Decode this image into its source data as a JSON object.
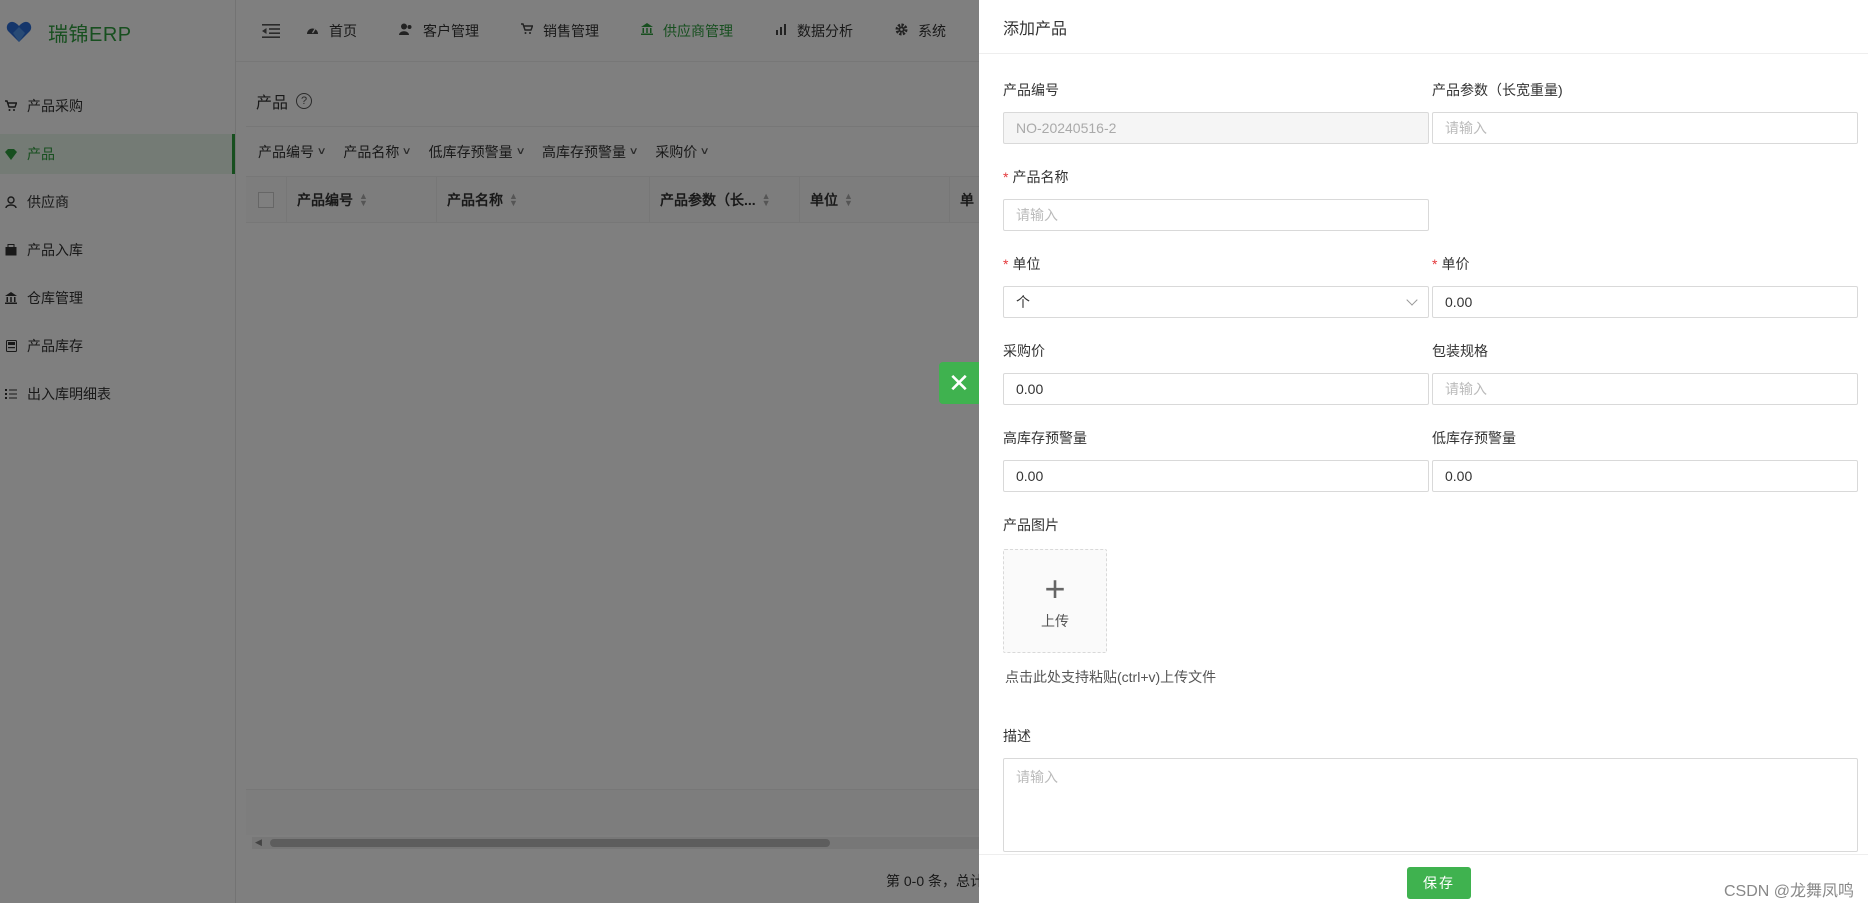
{
  "app": {
    "logo_text": "瑞锦ERP",
    "sidebar": {
      "items": [
        {
          "label": "产品采购",
          "icon": "cart-icon"
        },
        {
          "label": "产品",
          "icon": "diamond-icon",
          "active": true
        },
        {
          "label": "供应商",
          "icon": "user-icon"
        },
        {
          "label": "产品入库",
          "icon": "box-icon"
        },
        {
          "label": "仓库管理",
          "icon": "bank-icon"
        },
        {
          "label": "产品库存",
          "icon": "inventory-icon"
        },
        {
          "label": "出入库明细表",
          "icon": "list-icon"
        }
      ]
    },
    "topnav": {
      "tabs": [
        {
          "label": "首页",
          "icon": "dashboard-icon"
        },
        {
          "label": "客户管理",
          "icon": "users-icon"
        },
        {
          "label": "销售管理",
          "icon": "cart-icon"
        },
        {
          "label": "供应商管理",
          "icon": "bank-icon",
          "active": true
        },
        {
          "label": "数据分析",
          "icon": "chart-icon"
        },
        {
          "label": "系统",
          "icon": "gear-icon"
        }
      ]
    },
    "page": {
      "title": "产品",
      "filters": [
        "产品编号",
        "产品名称",
        "低库存预警量",
        "高库存预警量",
        "采购价"
      ],
      "columns": [
        "产品编号",
        "产品名称",
        "产品参数（长...",
        "单位",
        "单"
      ],
      "pager_text": "第 0-0 条，总计"
    }
  },
  "drawer": {
    "title": "添加产品",
    "fields": {
      "product_no": {
        "label": "产品编号",
        "value": "NO-20240516-2"
      },
      "product_params": {
        "label": "产品参数（长宽重量)",
        "placeholder": "请输入"
      },
      "product_name": {
        "label": "产品名称",
        "placeholder": "请输入",
        "required": true
      },
      "unit": {
        "label": "单位",
        "value": "个",
        "required": true
      },
      "unit_price": {
        "label": "单价",
        "value": "0.00",
        "required": true
      },
      "purchase_price": {
        "label": "采购价",
        "value": "0.00"
      },
      "package_spec": {
        "label": "包装规格",
        "placeholder": "请输入"
      },
      "high_stock_alert": {
        "label": "高库存预警量",
        "value": "0.00"
      },
      "low_stock_alert": {
        "label": "低库存预警量",
        "value": "0.00"
      },
      "product_image": {
        "label": "产品图片",
        "upload_text": "上传",
        "paste_hint": "点击此处支持粘贴(ctrl+v)上传文件"
      },
      "description": {
        "label": "描述",
        "placeholder": "请输入"
      }
    },
    "save_label": "保存",
    "close_symbol": "✕"
  },
  "watermark": "CSDN @龙舞凤鸣",
  "colors": {
    "brand": "#2e9e3e",
    "button": "#3fb24f",
    "required": "#e4393c"
  }
}
